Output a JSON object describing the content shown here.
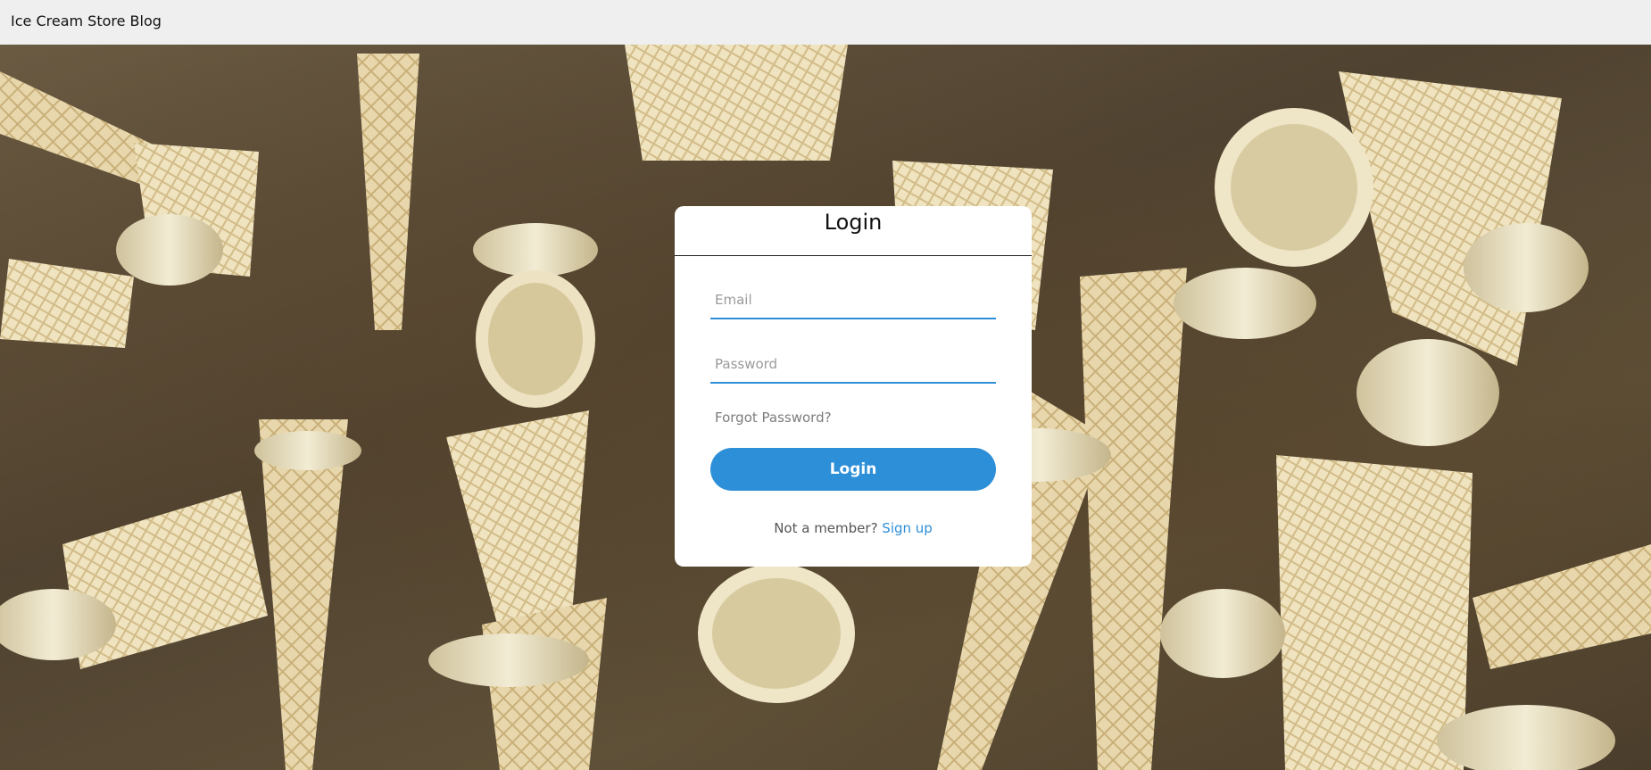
{
  "topbar": {
    "brand": "Ice Cream Store Blog"
  },
  "background": {
    "description_icon": "ice-cream-cones-photo"
  },
  "login_card": {
    "title": "Login",
    "email_placeholder": "Email",
    "email_value": "",
    "password_placeholder": "Password",
    "password_value": "",
    "forgot_label": "Forgot Password?",
    "login_button": "Login",
    "member_prompt": "Not a member?",
    "signup_link": "Sign up"
  },
  "colors": {
    "accent": "#2d8fd8",
    "topbar_bg": "#efefef",
    "card_bg": "#ffffff"
  }
}
